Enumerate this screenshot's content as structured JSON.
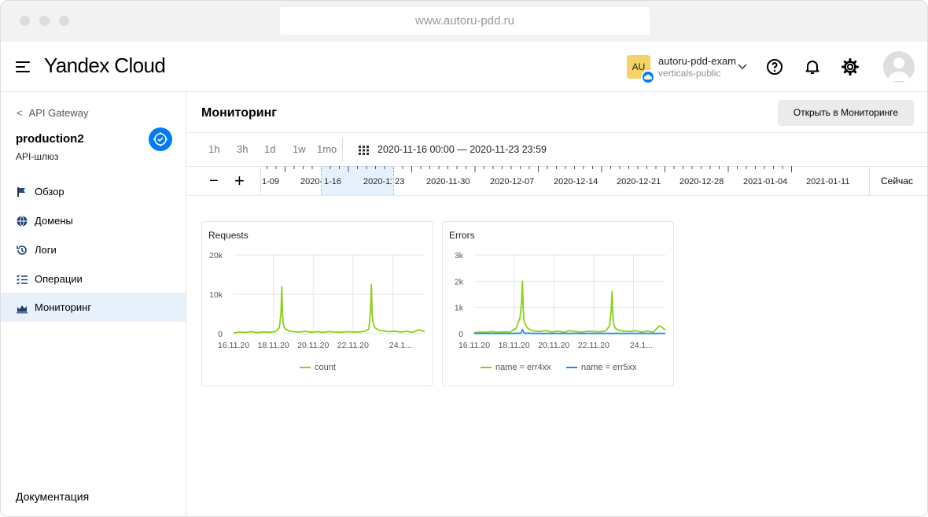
{
  "browser": {
    "url": "www.autoru-pdd.ru"
  },
  "header": {
    "logo_brand": "Yandex",
    "logo_product": "Cloud",
    "account_badge": "AU",
    "account_name": "autoru-pdd-exam",
    "folder_name": "verticals-public"
  },
  "sidebar": {
    "back_label": "API Gateway",
    "service_name": "production2",
    "service_type": "API-шлюз",
    "items": [
      {
        "label": "Обзор",
        "icon": "flag-icon"
      },
      {
        "label": "Домены",
        "icon": "globe-icon"
      },
      {
        "label": "Логи",
        "icon": "history-icon"
      },
      {
        "label": "Операции",
        "icon": "checklist-icon"
      },
      {
        "label": "Мониторинг",
        "icon": "chart-icon"
      }
    ],
    "docs_label": "Документация"
  },
  "main": {
    "title": "Мониторинг",
    "open_button": "Открыть в Мониторинге",
    "ranges": [
      "1h",
      "3h",
      "1d",
      "1w",
      "1mo"
    ],
    "range_text": "2020-11-16 00:00 — 2020-11-23 23:59",
    "timeline": {
      "labels": [
        "1-09",
        "2020-11-16",
        "2020-11-23",
        "2020-11-30",
        "2020-12-07",
        "2020-12-14",
        "2020-12-21",
        "2020-12-28",
        "2021-01-04",
        "2021-01-11"
      ],
      "now_label": "Сейчас"
    }
  },
  "colors": {
    "accent": "#027bf3",
    "series_green": "#8ad113",
    "series_blue": "#1d8cf0"
  },
  "chart_data": [
    {
      "type": "line",
      "title": "Requests",
      "x_ticks": [
        "16.11.20",
        "18.11.20",
        "20.11.20",
        "22.11.20",
        "24.1..."
      ],
      "y_ticks": [
        "20k",
        "10k",
        "0"
      ],
      "ylim": [
        0,
        20000
      ],
      "series": [
        {
          "name": "count",
          "color": "#8ad113",
          "x": [
            0,
            0.3,
            0.6,
            0.9,
            1.2,
            1.5,
            1.8,
            2.1,
            2.3,
            2.38,
            2.42,
            2.46,
            2.5,
            2.55,
            2.6,
            2.7,
            2.8,
            3.0,
            3.3,
            3.6,
            3.9,
            4.2,
            4.5,
            4.8,
            5.1,
            5.4,
            5.7,
            6.0,
            6.3,
            6.6,
            6.8,
            6.88,
            6.92,
            6.96,
            7.0,
            7.05,
            7.1,
            7.2,
            7.3,
            7.5,
            7.8,
            8.1,
            8.4,
            8.7,
            9.0,
            9.3,
            9.6
          ],
          "y": [
            200,
            400,
            300,
            500,
            250,
            450,
            350,
            500,
            1500,
            5000,
            12000,
            4500,
            2500,
            1600,
            1200,
            900,
            700,
            500,
            400,
            600,
            350,
            500,
            300,
            550,
            400,
            350,
            500,
            450,
            400,
            600,
            1200,
            6000,
            12500,
            5000,
            3000,
            2000,
            1500,
            1200,
            900,
            700,
            500,
            650,
            400,
            600,
            350,
            1000,
            500
          ]
        }
      ]
    },
    {
      "type": "line",
      "title": "Errors",
      "x_ticks": [
        "16.11.20",
        "18.11.20",
        "20.11.20",
        "22.11.20",
        "24.1..."
      ],
      "y_ticks": [
        "3k",
        "2k",
        "1k",
        "0"
      ],
      "ylim": [
        0,
        3000
      ],
      "series": [
        {
          "name": "name = err4xx",
          "color": "#8ad113",
          "x": [
            0,
            0.3,
            0.6,
            0.9,
            1.2,
            1.5,
            1.8,
            2.1,
            2.3,
            2.38,
            2.42,
            2.46,
            2.5,
            2.55,
            2.6,
            2.7,
            2.8,
            3.0,
            3.3,
            3.6,
            3.9,
            4.2,
            4.5,
            4.8,
            5.1,
            5.4,
            5.7,
            6.0,
            6.3,
            6.6,
            6.8,
            6.88,
            6.92,
            6.96,
            7.0,
            7.05,
            7.1,
            7.2,
            7.3,
            7.5,
            7.8,
            8.1,
            8.4,
            8.7,
            9.0,
            9.3,
            9.6
          ],
          "y": [
            40,
            60,
            50,
            80,
            50,
            70,
            60,
            200,
            600,
            1200,
            2000,
            900,
            500,
            400,
            300,
            200,
            150,
            100,
            80,
            120,
            60,
            100,
            50,
            110,
            80,
            60,
            90,
            80,
            70,
            100,
            300,
            900,
            1600,
            700,
            400,
            250,
            200,
            150,
            120,
            100,
            80,
            110,
            60,
            100,
            60,
            300,
            150
          ]
        },
        {
          "name": "name = err5xx",
          "color": "#1d8cf0",
          "x": [
            0,
            1.0,
            2.0,
            2.35,
            2.42,
            2.5,
            3.0,
            4.0,
            5.0,
            6.0,
            7.0,
            8.0,
            9.0,
            9.6
          ],
          "y": [
            10,
            10,
            10,
            20,
            150,
            20,
            10,
            10,
            10,
            10,
            10,
            10,
            10,
            10
          ]
        }
      ]
    }
  ]
}
